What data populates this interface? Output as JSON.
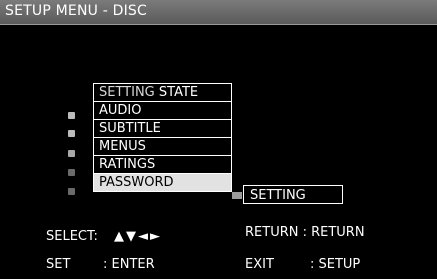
{
  "title": "SETUP MENU - DISC",
  "menu": {
    "header_prefix": "SETTING",
    "header_state": "STATE",
    "items": [
      {
        "label": "AUDIO"
      },
      {
        "label": "SUBTITLE"
      },
      {
        "label": "MENUS"
      },
      {
        "label": "RATINGS"
      },
      {
        "label": "PASSWORD",
        "selected": true
      }
    ]
  },
  "submenu": {
    "label": "SETTING"
  },
  "footer": {
    "select_label": "SELECT:",
    "select_arrows": "▲▼◄►",
    "return_label": "RETURN : RETURN",
    "set_label": "SET",
    "enter_label": ": ENTER",
    "exit_label": "EXIT",
    "setup_label": ": SETUP"
  },
  "colors": {
    "title_bar": "#6b6b6b",
    "selected_row": "#e2e2e2",
    "background": "#000000"
  }
}
